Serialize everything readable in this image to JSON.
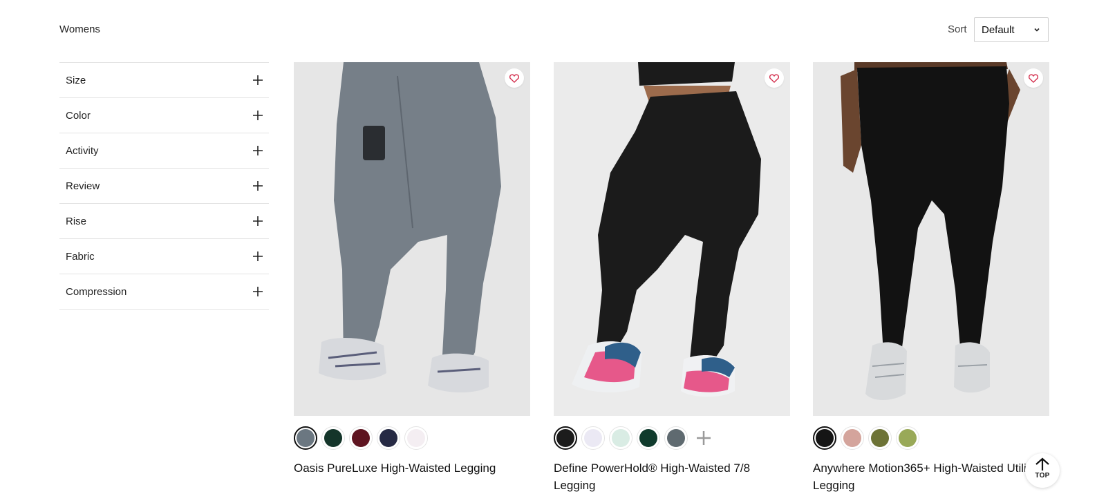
{
  "page": {
    "heading": "Womens"
  },
  "sort": {
    "label": "Sort",
    "value": "Default"
  },
  "filters": [
    {
      "label": "Size"
    },
    {
      "label": "Color"
    },
    {
      "label": "Activity"
    },
    {
      "label": "Review"
    },
    {
      "label": "Rise"
    },
    {
      "label": "Fabric"
    },
    {
      "label": "Compression"
    }
  ],
  "products": [
    {
      "name": "Oasis PureLuxe High-Waisted Legging",
      "legging_color": "#767f88",
      "swatches": [
        "#6b7781",
        "#14352a",
        "#5e1420",
        "#262a44",
        "#f4eef2"
      ],
      "more_colors": false
    },
    {
      "name": "Define PowerHold® High-Waisted 7/8 Legging",
      "legging_color": "#1b1b1b",
      "swatches": [
        "#1c1c1c",
        "#ebe9f4",
        "#d9ece4",
        "#0f3a2c",
        "#5f6a70"
      ],
      "more_colors": true
    },
    {
      "name": "Anywhere Motion365+ High-Waisted Utility Legging",
      "legging_color": "#121212",
      "swatches": [
        "#151515",
        "#d4a49c",
        "#6d7336",
        "#99a958"
      ],
      "more_colors": false
    }
  ],
  "scroll_top": {
    "label": "TOP"
  }
}
